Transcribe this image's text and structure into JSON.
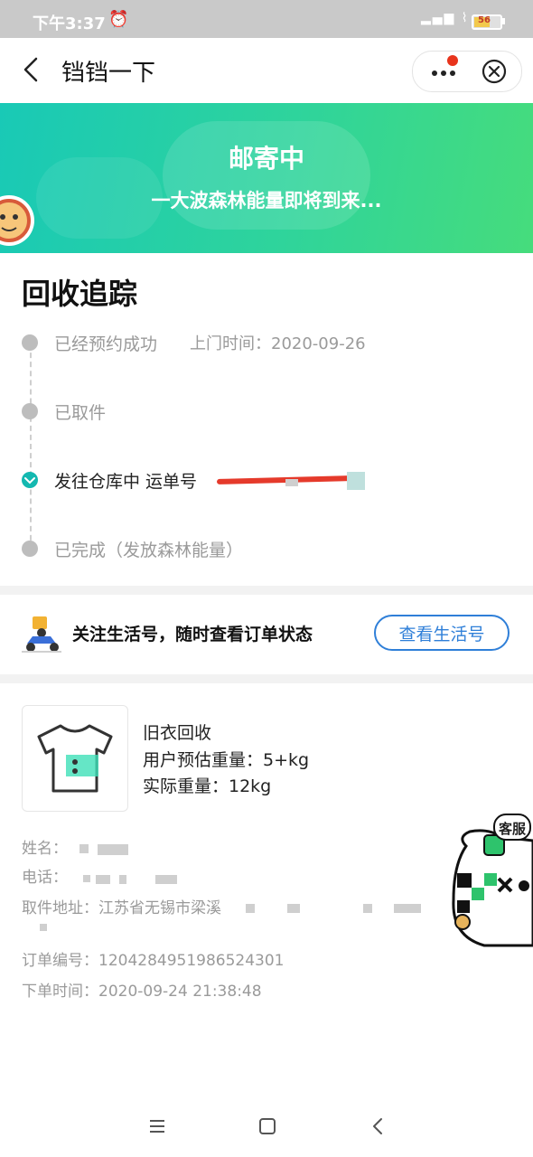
{
  "status_bar": {
    "time": "下午3:37",
    "battery": "56"
  },
  "nav": {
    "title": "铛铛一下"
  },
  "banner": {
    "title": "邮寄中",
    "subtitle": "一大波森林能量即将到来..."
  },
  "tracking": {
    "title": "回收追踪",
    "steps": [
      {
        "label": "已经预约成功",
        "extra": "上门时间：2020-09-26",
        "state": "done"
      },
      {
        "label": "已取件",
        "extra": "",
        "state": "done"
      },
      {
        "label": "发往仓库中 运单号",
        "extra": "",
        "state": "active"
      },
      {
        "label": "已完成（发放森林能量）",
        "extra": "",
        "state": "pending"
      }
    ]
  },
  "follow": {
    "text": "关注生活号，随时查看订单状态",
    "button": "查看生活号"
  },
  "order": {
    "product": "旧衣回收",
    "estimated_weight": "用户预估重量：5+kg",
    "actual_weight": "实际重量：12kg",
    "name_label": "姓名：",
    "phone_label": "电话：",
    "address_label": "取件地址：",
    "address_value": "江苏省无锡市梁溪",
    "order_no_label": "订单编号：",
    "order_no": "1204284951986524301",
    "order_time_label": "下单时间：",
    "order_time": "2020-09-24 21:38:48"
  },
  "service": {
    "label": "客服"
  },
  "colors": {
    "accent": "#14b8b0",
    "link": "#2f7fd8",
    "banner_start": "#19c9b6",
    "banner_end": "#46dc7c",
    "redaction": "#e53a2b"
  },
  "icons": [
    "back-icon",
    "more-icon",
    "close-circle-icon",
    "check-icon",
    "scooter-icon",
    "tshirt-icon",
    "menu-icon",
    "home-square-icon",
    "back-triangle-icon"
  ]
}
